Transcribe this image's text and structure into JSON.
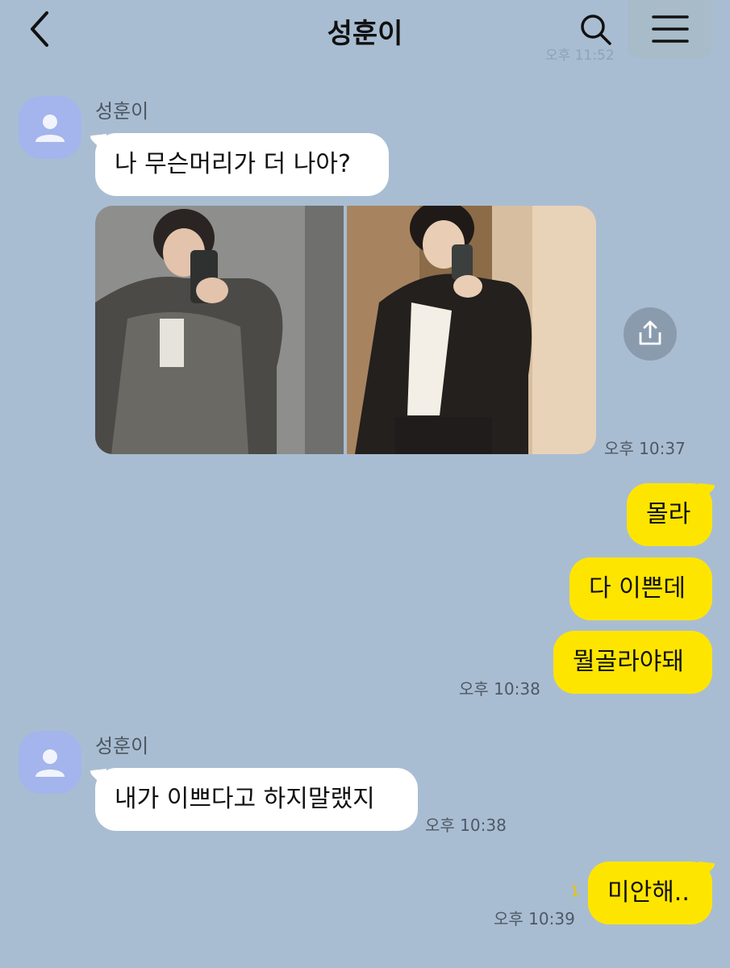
{
  "header": {
    "title": "성훈이",
    "ghost_time": "오후 11:52"
  },
  "messages": {
    "m1_sender": "성훈이",
    "m1_text": "나 무슨머리가 더 나아?",
    "m1_time": "오후 10:37",
    "r1_text": "몰라",
    "r2_text": "다 이쁜데",
    "r3_text": "뭘골라야돼",
    "r3_time": "오후 10:38",
    "m2_sender": "성훈이",
    "m2_text": "내가 이쁘다고 하지말랬지",
    "m2_time": "오후 10:38",
    "r4_text": "미안해..",
    "r4_unread": "1",
    "r4_time": "오후 10:39"
  },
  "icons": {
    "back": "back-chevron-icon",
    "search": "search-icon",
    "menu": "hamburger-menu-icon",
    "share": "share-icon",
    "avatar": "default-profile-icon"
  },
  "colors": {
    "background": "#a9bdd2",
    "my_bubble": "#fee500",
    "their_bubble": "#ffffff",
    "avatar": "#a4b4ec"
  }
}
